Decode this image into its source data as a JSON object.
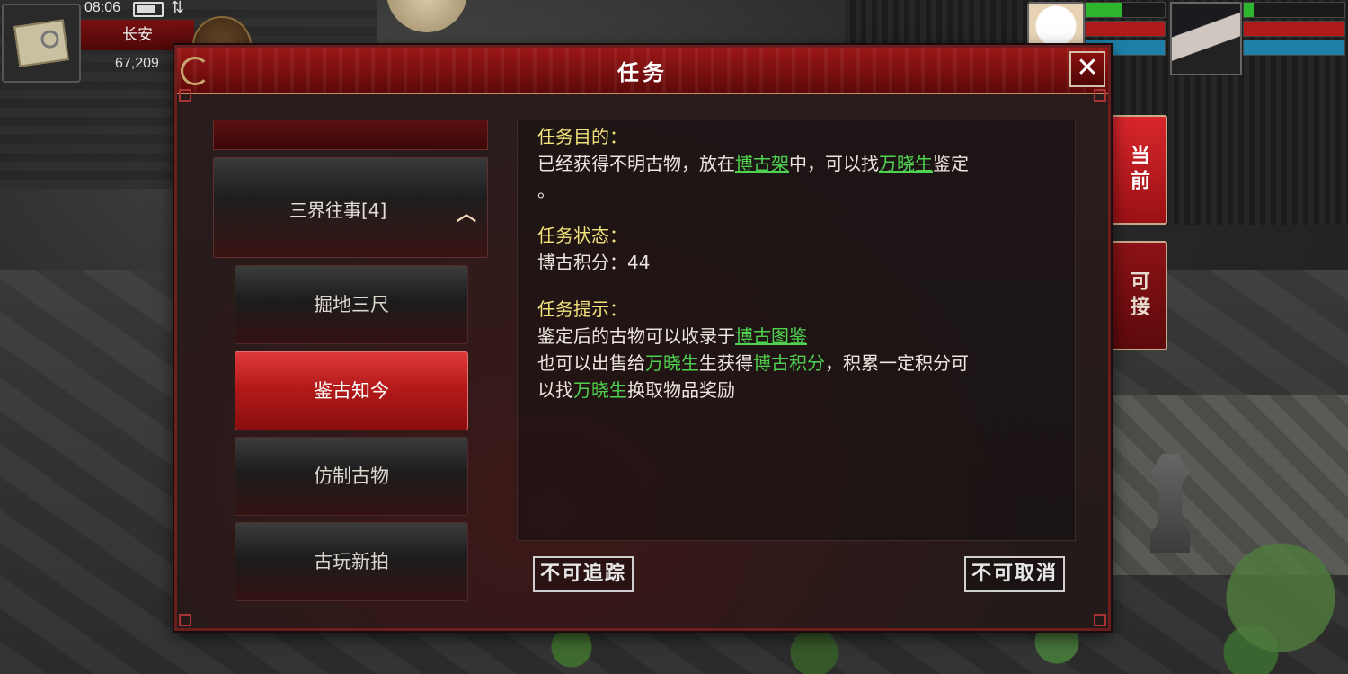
{
  "hud": {
    "time": "08:06",
    "signal": "⇅",
    "location": "长安",
    "coords": "67,209"
  },
  "dialog": {
    "title": "任务",
    "close_glyph": "✕"
  },
  "side_tabs": {
    "current": "当前",
    "available": "可接"
  },
  "quest_list": {
    "category": "三界往事[4]",
    "category_arrow": "︿",
    "items": [
      {
        "label": "掘地三尺"
      },
      {
        "label": "鉴古知今",
        "selected": true
      },
      {
        "label": "仿制古物"
      },
      {
        "label": "古玩新拍"
      }
    ]
  },
  "quest_detail": {
    "goal_heading": "任务目的：",
    "goal_text_1": "已经获得不明古物，放在",
    "goal_link_1": "博古架",
    "goal_text_2": "中，可以找",
    "goal_link_2": "万晓生",
    "goal_text_3": "鉴定",
    "goal_text_4": "。",
    "status_heading": "任务状态：",
    "status_text": "博古积分：44",
    "hint_heading": "任务提示：",
    "hint_line1_text": "鉴定后的古物可以收录于",
    "hint_line1_link": "博古图鉴",
    "hint_line2_a": "也可以出售给",
    "hint_line2_link1": "万晓生",
    "hint_line2_b": "生获得",
    "hint_line2_link2": "博古积分",
    "hint_line2_c": "，积累一定积分可",
    "hint_line3_a": "以找",
    "hint_line3_link": "万晓生",
    "hint_line3_b": "换取物品奖励"
  },
  "footer": {
    "track_button": "不可追踪",
    "cancel_button": "不可取消"
  },
  "colors": {
    "accent_red": "#b41a1a",
    "heading_yellow": "#f2e27a",
    "link_green": "#4fd24f"
  },
  "status_bars": {
    "pet": {
      "hp": 0.45,
      "mp": 1.0,
      "sp": 1.0
    },
    "hero": {
      "hp": 0.1,
      "mp": 1.0,
      "sp": 1.0
    }
  }
}
